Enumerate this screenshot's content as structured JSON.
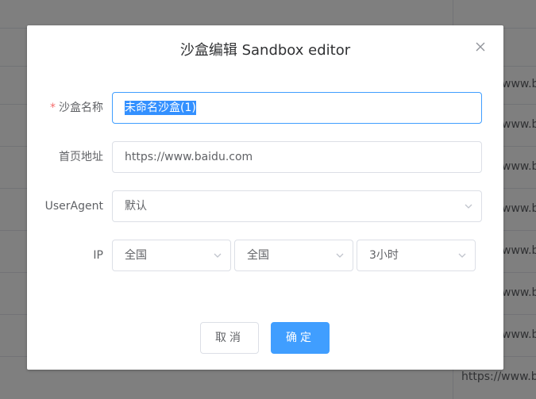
{
  "background_table": {
    "url_cells": [
      "www.b",
      "www.b",
      "www.b",
      "www.b",
      "www.b",
      "www.b",
      "www.b",
      "https://www.b"
    ]
  },
  "dialog": {
    "title": "沙盒编辑 Sandbox editor",
    "fields": {
      "name": {
        "required_mark": "*",
        "label": "沙盒名称",
        "value": "未命名沙盒(1)"
      },
      "homepage": {
        "label": "首页地址",
        "value": "https://www.baidu.com"
      },
      "user_agent": {
        "label": "UserAgent",
        "value": "默认"
      },
      "ip": {
        "label": "IP",
        "region1": "全国",
        "region2": "全国",
        "duration": "3小时"
      }
    },
    "buttons": {
      "cancel": "取消",
      "confirm": "确定"
    }
  },
  "colors": {
    "primary": "#409eff",
    "required": "#f56c6c",
    "selection": "#3390ff"
  }
}
